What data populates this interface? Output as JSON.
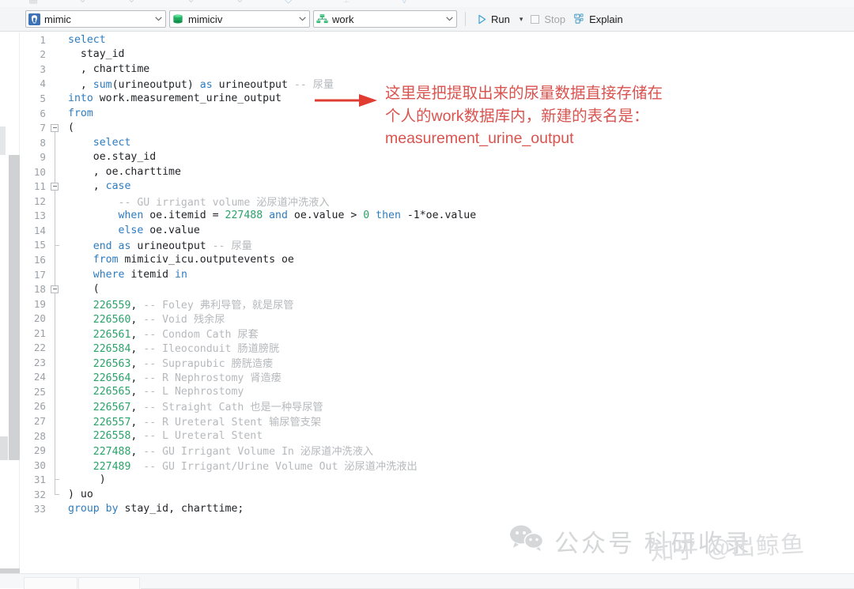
{
  "toolbar": {
    "connection": {
      "label": "mimic",
      "icon": "postgres-elephant-icon"
    },
    "database": {
      "label": "mimiciv",
      "icon": "database-cylinder-icon"
    },
    "schema": {
      "label": "work",
      "icon": "schema-tree-icon"
    },
    "run_label": "Run",
    "stop_label": "Stop",
    "explain_label": "Explain"
  },
  "editor": {
    "lines": [
      {
        "n": "1",
        "tokens": [
          {
            "t": "select",
            "c": "kw"
          }
        ]
      },
      {
        "n": "2",
        "tokens": [
          {
            "t": "  stay_id",
            "c": "id"
          }
        ]
      },
      {
        "n": "3",
        "tokens": [
          {
            "t": "  , charttime",
            "c": "id"
          }
        ]
      },
      {
        "n": "4",
        "tokens": [
          {
            "t": "  , ",
            "c": "id"
          },
          {
            "t": "sum",
            "c": "fn"
          },
          {
            "t": "(urineoutput) ",
            "c": "id"
          },
          {
            "t": "as",
            "c": "kw"
          },
          {
            "t": " urineoutput ",
            "c": "id"
          },
          {
            "t": "-- 尿量",
            "c": "cmt"
          }
        ]
      },
      {
        "n": "5",
        "tokens": [
          {
            "t": "into",
            "c": "kw"
          },
          {
            "t": " work.measurement_urine_output",
            "c": "id"
          }
        ]
      },
      {
        "n": "6",
        "tokens": [
          {
            "t": "from",
            "c": "kw"
          }
        ]
      },
      {
        "n": "7",
        "tokens": [
          {
            "t": "(",
            "c": "id"
          }
        ],
        "fold": "box-top"
      },
      {
        "n": "8",
        "tokens": [
          {
            "t": "    ",
            "c": "id"
          },
          {
            "t": "select",
            "c": "kw"
          }
        ],
        "fold": "rail"
      },
      {
        "n": "9",
        "tokens": [
          {
            "t": "    oe.stay_id",
            "c": "id"
          }
        ],
        "fold": "rail"
      },
      {
        "n": "10",
        "tokens": [
          {
            "t": "    , oe.charttime",
            "c": "id"
          }
        ],
        "fold": "rail"
      },
      {
        "n": "11",
        "tokens": [
          {
            "t": "    , ",
            "c": "id"
          },
          {
            "t": "case",
            "c": "kw"
          }
        ],
        "fold": "box-mid"
      },
      {
        "n": "12",
        "tokens": [
          {
            "t": "        ",
            "c": "id"
          },
          {
            "t": "-- GU irrigant volume 泌尿道冲洗液入",
            "c": "cmt"
          }
        ],
        "fold": "rail"
      },
      {
        "n": "13",
        "tokens": [
          {
            "t": "        ",
            "c": "id"
          },
          {
            "t": "when",
            "c": "kw"
          },
          {
            "t": " oe.itemid = ",
            "c": "id"
          },
          {
            "t": "227488",
            "c": "num"
          },
          {
            "t": " ",
            "c": "id"
          },
          {
            "t": "and",
            "c": "kw"
          },
          {
            "t": " oe.value > ",
            "c": "id"
          },
          {
            "t": "0",
            "c": "num"
          },
          {
            "t": " ",
            "c": "id"
          },
          {
            "t": "then",
            "c": "kw"
          },
          {
            "t": " -1*oe.value",
            "c": "id"
          }
        ],
        "fold": "rail"
      },
      {
        "n": "14",
        "tokens": [
          {
            "t": "        ",
            "c": "id"
          },
          {
            "t": "else",
            "c": "kw"
          },
          {
            "t": " oe.value",
            "c": "id"
          }
        ],
        "fold": "rail"
      },
      {
        "n": "15",
        "tokens": [
          {
            "t": "    ",
            "c": "id"
          },
          {
            "t": "end",
            "c": "kw"
          },
          {
            "t": " ",
            "c": "id"
          },
          {
            "t": "as",
            "c": "kw"
          },
          {
            "t": " urineoutput ",
            "c": "id"
          },
          {
            "t": "-- 尿量",
            "c": "cmt"
          }
        ],
        "fold": "tick"
      },
      {
        "n": "16",
        "tokens": [
          {
            "t": "    ",
            "c": "id"
          },
          {
            "t": "from",
            "c": "kw"
          },
          {
            "t": " mimiciv_icu.outputevents oe",
            "c": "id"
          }
        ],
        "fold": "rail"
      },
      {
        "n": "17",
        "tokens": [
          {
            "t": "    ",
            "c": "id"
          },
          {
            "t": "where",
            "c": "kw"
          },
          {
            "t": " itemid ",
            "c": "id"
          },
          {
            "t": "in",
            "c": "kw"
          }
        ],
        "fold": "rail"
      },
      {
        "n": "18",
        "tokens": [
          {
            "t": "    (",
            "c": "id"
          }
        ],
        "fold": "box-mid"
      },
      {
        "n": "19",
        "tokens": [
          {
            "t": "    ",
            "c": "id"
          },
          {
            "t": "226559",
            "c": "num"
          },
          {
            "t": ", ",
            "c": "id"
          },
          {
            "t": "-- Foley 弗利导管，就是尿管",
            "c": "cmt"
          }
        ],
        "fold": "rail"
      },
      {
        "n": "20",
        "tokens": [
          {
            "t": "    ",
            "c": "id"
          },
          {
            "t": "226560",
            "c": "num"
          },
          {
            "t": ", ",
            "c": "id"
          },
          {
            "t": "-- Void 残余尿",
            "c": "cmt"
          }
        ],
        "fold": "rail"
      },
      {
        "n": "21",
        "tokens": [
          {
            "t": "    ",
            "c": "id"
          },
          {
            "t": "226561",
            "c": "num"
          },
          {
            "t": ", ",
            "c": "id"
          },
          {
            "t": "-- Condom Cath 尿套",
            "c": "cmt"
          }
        ],
        "fold": "rail"
      },
      {
        "n": "22",
        "tokens": [
          {
            "t": "    ",
            "c": "id"
          },
          {
            "t": "226584",
            "c": "num"
          },
          {
            "t": ", ",
            "c": "id"
          },
          {
            "t": "-- Ileoconduit 肠道膀胱",
            "c": "cmt"
          }
        ],
        "fold": "rail"
      },
      {
        "n": "23",
        "tokens": [
          {
            "t": "    ",
            "c": "id"
          },
          {
            "t": "226563",
            "c": "num"
          },
          {
            "t": ", ",
            "c": "id"
          },
          {
            "t": "-- Suprapubic 膀胱造瘘",
            "c": "cmt"
          }
        ],
        "fold": "rail"
      },
      {
        "n": "24",
        "tokens": [
          {
            "t": "    ",
            "c": "id"
          },
          {
            "t": "226564",
            "c": "num"
          },
          {
            "t": ", ",
            "c": "id"
          },
          {
            "t": "-- R Nephrostomy 肾造瘘",
            "c": "cmt"
          }
        ],
        "fold": "rail"
      },
      {
        "n": "25",
        "tokens": [
          {
            "t": "    ",
            "c": "id"
          },
          {
            "t": "226565",
            "c": "num"
          },
          {
            "t": ", ",
            "c": "id"
          },
          {
            "t": "-- L Nephrostomy",
            "c": "cmt"
          }
        ],
        "fold": "rail"
      },
      {
        "n": "26",
        "tokens": [
          {
            "t": "    ",
            "c": "id"
          },
          {
            "t": "226567",
            "c": "num"
          },
          {
            "t": ", ",
            "c": "id"
          },
          {
            "t": "-- Straight Cath 也是一种导尿管",
            "c": "cmt"
          }
        ],
        "fold": "rail"
      },
      {
        "n": "27",
        "tokens": [
          {
            "t": "    ",
            "c": "id"
          },
          {
            "t": "226557",
            "c": "num"
          },
          {
            "t": ", ",
            "c": "id"
          },
          {
            "t": "-- R Ureteral Stent 输尿管支架",
            "c": "cmt"
          }
        ],
        "fold": "rail"
      },
      {
        "n": "28",
        "tokens": [
          {
            "t": "    ",
            "c": "id"
          },
          {
            "t": "226558",
            "c": "num"
          },
          {
            "t": ", ",
            "c": "id"
          },
          {
            "t": "-- L Ureteral Stent",
            "c": "cmt"
          }
        ],
        "fold": "rail"
      },
      {
        "n": "29",
        "tokens": [
          {
            "t": "    ",
            "c": "id"
          },
          {
            "t": "227488",
            "c": "num"
          },
          {
            "t": ", ",
            "c": "id"
          },
          {
            "t": "-- GU Irrigant Volume In 泌尿道冲洗液入",
            "c": "cmt"
          }
        ],
        "fold": "rail"
      },
      {
        "n": "30",
        "tokens": [
          {
            "t": "    ",
            "c": "id"
          },
          {
            "t": "227489",
            "c": "num"
          },
          {
            "t": "  ",
            "c": "id"
          },
          {
            "t": "-- GU Irrigant/Urine Volume Out 泌尿道冲洗液出",
            "c": "cmt"
          }
        ],
        "fold": "rail"
      },
      {
        "n": "31",
        "tokens": [
          {
            "t": "     )",
            "c": "id"
          }
        ],
        "fold": "tick"
      },
      {
        "n": "32",
        "tokens": [
          {
            "t": ") uo",
            "c": "id"
          }
        ],
        "fold": "end"
      },
      {
        "n": "33",
        "tokens": [
          {
            "t": "group",
            "c": "kw"
          },
          {
            "t": " ",
            "c": "id"
          },
          {
            "t": "by",
            "c": "kw"
          },
          {
            "t": " stay_id, charttime;",
            "c": "id"
          }
        ]
      }
    ]
  },
  "annotation": {
    "text": "这里是把提取出来的尿量数据直接存储在\n个人的work数据库内，新建的表名是：\nmeasurement_urine_output",
    "color": "#d9534f",
    "arrow": "red-right-arrow-icon"
  },
  "watermarks": {
    "wechat_label": "公众号 科研收录",
    "zhihu_label": "知乎 @出鲸鱼"
  },
  "colors": {
    "keyword": "#2d7cc0",
    "number": "#2aa36a",
    "comment": "#b6b9bc",
    "identifier": "#1f2125",
    "annotation_red": "#d9534f",
    "toolbar_bg": "#f4f5f6"
  }
}
